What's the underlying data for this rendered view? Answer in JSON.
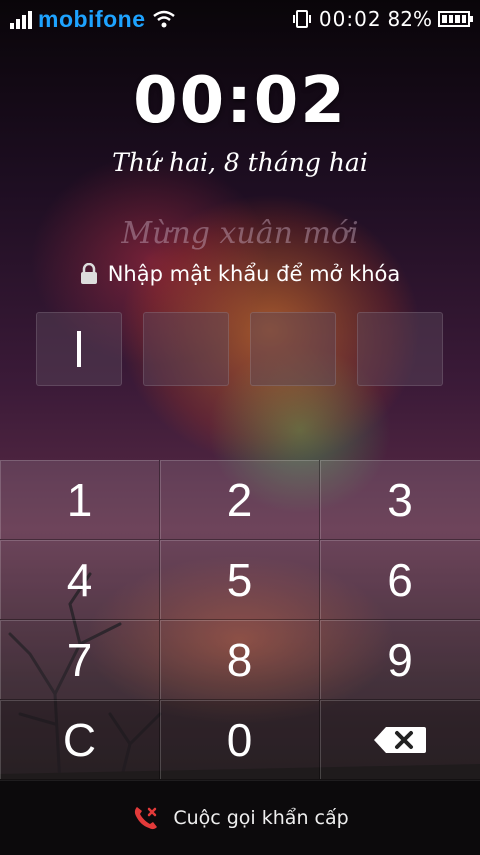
{
  "status_bar": {
    "carrier": "mobifone",
    "time": "00:02",
    "battery_percent": "82%",
    "battery_level": 0.82,
    "signal_bars": 4,
    "icons": [
      "signal-icon",
      "wifi-icon",
      "vibrate-icon",
      "battery-icon"
    ]
  },
  "lockscreen": {
    "clock": "00:02",
    "date": "Thứ hai, 8 tháng hai",
    "greeting": "Mừng xuân mới",
    "prompt": "Nhập mật khẩu để mở khóa",
    "pin_fields": 4,
    "pin_entered": 0
  },
  "keypad": {
    "keys": [
      "1",
      "2",
      "3",
      "4",
      "5",
      "6",
      "7",
      "8",
      "9",
      "C",
      "0"
    ],
    "backspace_icon": "backspace-icon"
  },
  "emergency": {
    "label": "Cuộc gọi khẩn cấp",
    "icon": "emergency-phone-icon",
    "icon_color": "#e23a3a"
  },
  "colors": {
    "carrier": "#1ea3ff",
    "text": "#ffffff"
  }
}
